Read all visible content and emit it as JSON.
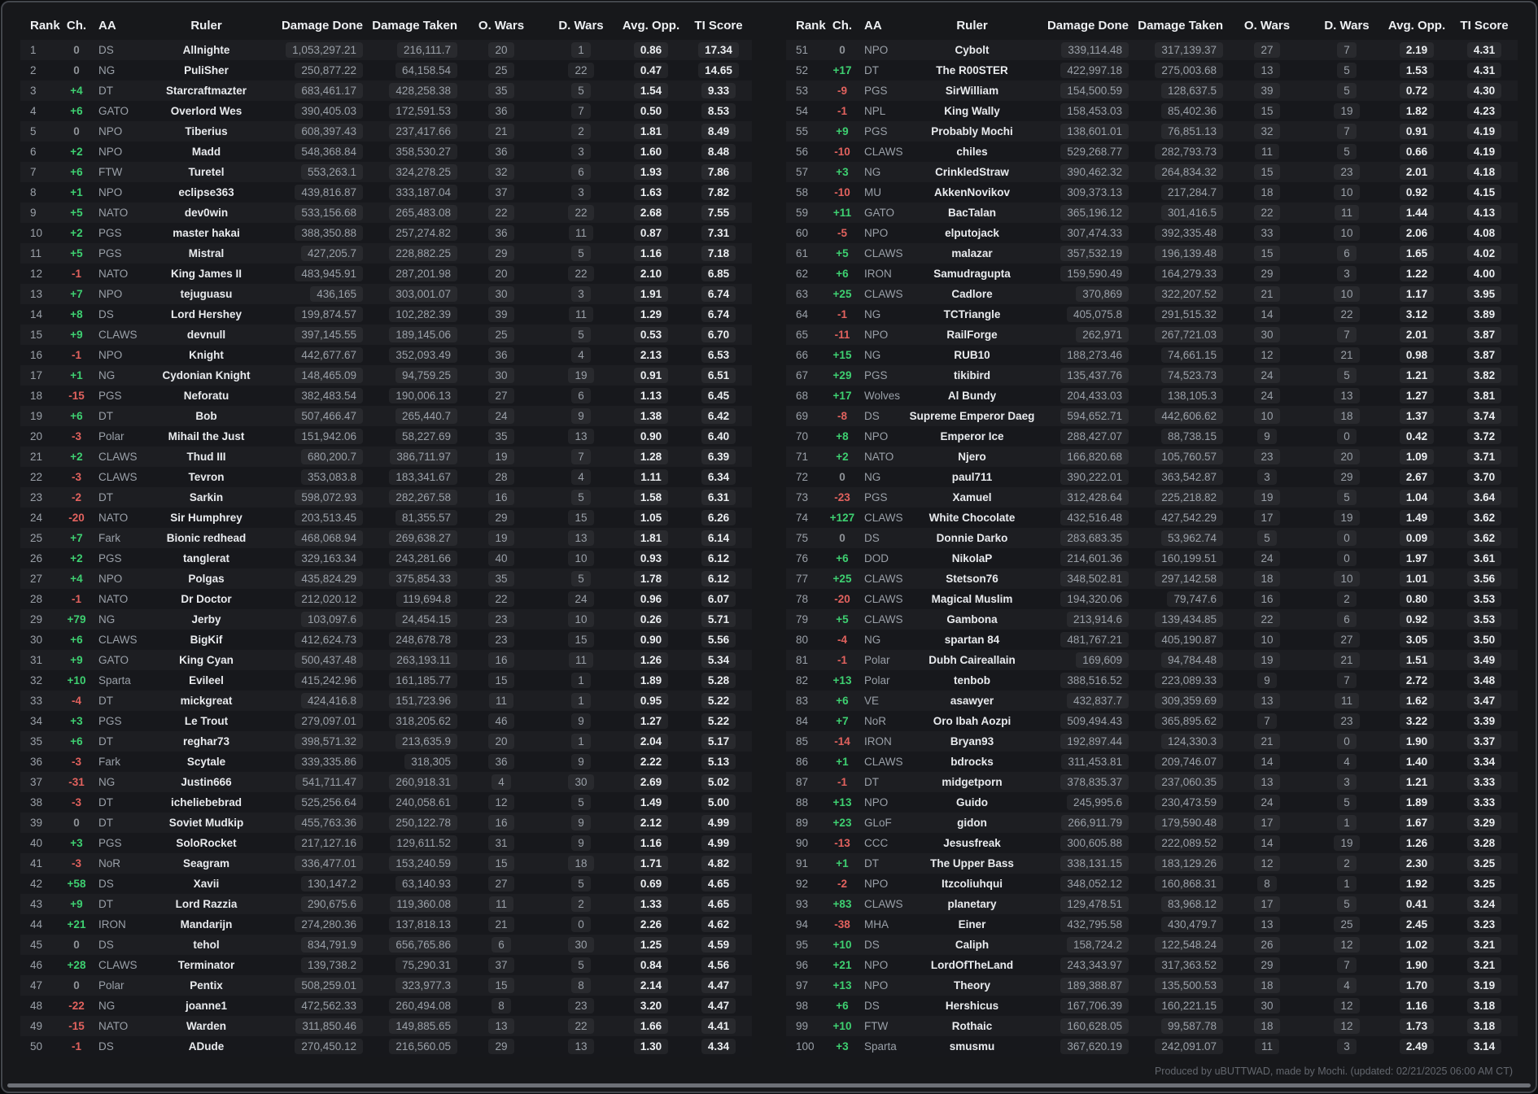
{
  "columns": [
    "Rank",
    "Ch.",
    "AA",
    "Ruler",
    "Damage Done",
    "Damage Taken",
    "O. Wars",
    "D. Wars",
    "Avg. Opp.",
    "TI Score"
  ],
  "colors": {
    "positive": "#3ed071",
    "negative": "#e2625e",
    "neutral": "#8f9398",
    "accent_bg": "#1d1e22"
  },
  "footer": {
    "text": "Produced by uBUTTWAD, made by Mochi. (updated: 02/21/2025 06:00 AM CT)"
  },
  "left_table": {
    "rows": [
      [
        "1",
        "0",
        "DS",
        "Allnighte",
        "1,053,297.21",
        "216,111.7",
        "20",
        "1",
        "0.86",
        "17.34"
      ],
      [
        "2",
        "0",
        "NG",
        "PuliSher",
        "250,877.22",
        "64,158.54",
        "25",
        "22",
        "0.47",
        "14.65"
      ],
      [
        "3",
        "+4",
        "DT",
        "Starcraftmazter",
        "683,461.17",
        "428,258.38",
        "35",
        "5",
        "1.54",
        "9.33"
      ],
      [
        "4",
        "+6",
        "GATO",
        "Overlord Wes",
        "390,405.03",
        "172,591.53",
        "36",
        "7",
        "0.50",
        "8.53"
      ],
      [
        "5",
        "0",
        "NPO",
        "Tiberius",
        "608,397.43",
        "237,417.66",
        "21",
        "2",
        "1.81",
        "8.49"
      ],
      [
        "6",
        "+2",
        "NPO",
        "Madd",
        "548,368.84",
        "358,530.27",
        "36",
        "3",
        "1.60",
        "8.48"
      ],
      [
        "7",
        "+6",
        "FTW",
        "Turetel",
        "553,263.1",
        "324,278.25",
        "32",
        "6",
        "1.93",
        "7.86"
      ],
      [
        "8",
        "+1",
        "NPO",
        "eclipse363",
        "439,816.87",
        "333,187.04",
        "37",
        "3",
        "1.63",
        "7.82"
      ],
      [
        "9",
        "+5",
        "NATO",
        "dev0win",
        "533,156.68",
        "265,483.08",
        "22",
        "22",
        "2.68",
        "7.55"
      ],
      [
        "10",
        "+2",
        "PGS",
        "master hakai",
        "388,350.88",
        "257,274.82",
        "36",
        "11",
        "0.87",
        "7.31"
      ],
      [
        "11",
        "+5",
        "PGS",
        "Mistral",
        "427,205.7",
        "228,882.25",
        "29",
        "5",
        "1.16",
        "7.18"
      ],
      [
        "12",
        "-1",
        "NATO",
        "King James II",
        "483,945.91",
        "287,201.98",
        "20",
        "22",
        "2.10",
        "6.85"
      ],
      [
        "13",
        "+7",
        "NPO",
        "tejuguasu",
        "436,165",
        "303,001.07",
        "30",
        "3",
        "1.91",
        "6.74"
      ],
      [
        "14",
        "+8",
        "DS",
        "Lord Hershey",
        "199,874.57",
        "102,282.39",
        "39",
        "11",
        "1.29",
        "6.74"
      ],
      [
        "15",
        "+9",
        "CLAWS",
        "devnull",
        "397,145.55",
        "189,145.06",
        "25",
        "5",
        "0.53",
        "6.70"
      ],
      [
        "16",
        "-1",
        "NPO",
        "Knight",
        "442,677.67",
        "352,093.49",
        "36",
        "4",
        "2.13",
        "6.53"
      ],
      [
        "17",
        "+1",
        "NG",
        "Cydonian Knight",
        "148,465.09",
        "94,759.25",
        "30",
        "19",
        "0.91",
        "6.51"
      ],
      [
        "18",
        "-15",
        "PGS",
        "Neforatu",
        "382,483.54",
        "190,006.13",
        "27",
        "6",
        "1.13",
        "6.45"
      ],
      [
        "19",
        "+6",
        "DT",
        "Bob",
        "507,466.47",
        "265,440.7",
        "24",
        "9",
        "1.38",
        "6.42"
      ],
      [
        "20",
        "-3",
        "Polar",
        "Mihail the Just",
        "151,942.06",
        "58,227.69",
        "35",
        "13",
        "0.90",
        "6.40"
      ],
      [
        "21",
        "+2",
        "CLAWS",
        "Thud III",
        "680,200.7",
        "386,711.97",
        "19",
        "7",
        "1.28",
        "6.39"
      ],
      [
        "22",
        "-3",
        "CLAWS",
        "Tevron",
        "353,083.8",
        "183,341.67",
        "28",
        "4",
        "1.11",
        "6.34"
      ],
      [
        "23",
        "-2",
        "DT",
        "Sarkin",
        "598,072.93",
        "282,267.58",
        "16",
        "5",
        "1.58",
        "6.31"
      ],
      [
        "24",
        "-20",
        "NATO",
        "Sir Humphrey",
        "203,513.45",
        "81,355.57",
        "29",
        "15",
        "1.05",
        "6.26"
      ],
      [
        "25",
        "+7",
        "Fark",
        "Bionic redhead",
        "468,068.94",
        "269,638.27",
        "19",
        "13",
        "1.81",
        "6.14"
      ],
      [
        "26",
        "+2",
        "PGS",
        "tanglerat",
        "329,163.34",
        "243,281.66",
        "40",
        "10",
        "0.93",
        "6.12"
      ],
      [
        "27",
        "+4",
        "NPO",
        "Polgas",
        "435,824.29",
        "375,854.33",
        "35",
        "5",
        "1.78",
        "6.12"
      ],
      [
        "28",
        "-1",
        "NATO",
        "Dr Doctor",
        "212,020.12",
        "119,694.8",
        "22",
        "24",
        "0.96",
        "6.07"
      ],
      [
        "29",
        "+79",
        "NG",
        "Jerby",
        "103,097.6",
        "24,454.15",
        "23",
        "10",
        "0.26",
        "5.71"
      ],
      [
        "30",
        "+6",
        "CLAWS",
        "BigKif",
        "412,624.73",
        "248,678.78",
        "23",
        "15",
        "0.90",
        "5.56"
      ],
      [
        "31",
        "+9",
        "GATO",
        "King Cyan",
        "500,437.48",
        "263,193.11",
        "16",
        "11",
        "1.26",
        "5.34"
      ],
      [
        "32",
        "+10",
        "Sparta",
        "Evileel",
        "415,242.96",
        "161,185.77",
        "15",
        "1",
        "1.89",
        "5.28"
      ],
      [
        "33",
        "-4",
        "DT",
        "mickgreat",
        "424,416.8",
        "151,723.96",
        "11",
        "1",
        "0.95",
        "5.22"
      ],
      [
        "34",
        "+3",
        "PGS",
        "Le Trout",
        "279,097.01",
        "318,205.62",
        "46",
        "9",
        "1.27",
        "5.22"
      ],
      [
        "35",
        "+6",
        "DT",
        "reghar73",
        "398,571.32",
        "213,635.9",
        "20",
        "1",
        "2.04",
        "5.17"
      ],
      [
        "36",
        "-3",
        "Fark",
        "Scytale",
        "339,335.86",
        "318,305",
        "36",
        "9",
        "2.22",
        "5.13"
      ],
      [
        "37",
        "-31",
        "NG",
        "Justin666",
        "541,711.47",
        "260,918.31",
        "4",
        "30",
        "2.69",
        "5.02"
      ],
      [
        "38",
        "-3",
        "DT",
        "icheliebebrad",
        "525,256.64",
        "240,058.61",
        "12",
        "5",
        "1.49",
        "5.00"
      ],
      [
        "39",
        "0",
        "DT",
        "Soviet Mudkip",
        "455,763.36",
        "250,122.78",
        "16",
        "9",
        "2.12",
        "4.99"
      ],
      [
        "40",
        "+3",
        "PGS",
        "SoloRocket",
        "217,127.16",
        "129,611.52",
        "31",
        "9",
        "1.16",
        "4.99"
      ],
      [
        "41",
        "-3",
        "NoR",
        "Seagram",
        "336,477.01",
        "153,240.59",
        "15",
        "18",
        "1.71",
        "4.82"
      ],
      [
        "42",
        "+58",
        "DS",
        "Xavii",
        "130,147.2",
        "63,140.93",
        "27",
        "5",
        "0.69",
        "4.65"
      ],
      [
        "43",
        "+9",
        "DT",
        "Lord Razzia",
        "290,675.6",
        "119,360.08",
        "11",
        "2",
        "1.33",
        "4.65"
      ],
      [
        "44",
        "+21",
        "IRON",
        "Mandarijn",
        "274,280.36",
        "137,818.13",
        "21",
        "0",
        "2.26",
        "4.62"
      ],
      [
        "45",
        "0",
        "DS",
        "tehol",
        "834,791.9",
        "656,765.86",
        "6",
        "30",
        "1.25",
        "4.59"
      ],
      [
        "46",
        "+28",
        "CLAWS",
        "Terminator",
        "139,738.2",
        "75,290.31",
        "37",
        "5",
        "0.84",
        "4.56"
      ],
      [
        "47",
        "0",
        "Polar",
        "Pentix",
        "508,259.01",
        "323,977.3",
        "15",
        "8",
        "2.14",
        "4.47"
      ],
      [
        "48",
        "-22",
        "NG",
        "joanne1",
        "472,562.33",
        "260,494.08",
        "8",
        "23",
        "3.20",
        "4.47"
      ],
      [
        "49",
        "-15",
        "NATO",
        "Warden",
        "311,850.46",
        "149,885.65",
        "13",
        "22",
        "1.66",
        "4.41"
      ],
      [
        "50",
        "-1",
        "DS",
        "ADude",
        "270,450.12",
        "216,560.05",
        "29",
        "13",
        "1.30",
        "4.34"
      ]
    ]
  },
  "right_table": {
    "rows": [
      [
        "51",
        "0",
        "NPO",
        "Cybolt",
        "339,114.48",
        "317,139.37",
        "27",
        "7",
        "2.19",
        "4.31"
      ],
      [
        "52",
        "+17",
        "DT",
        "The R00STER",
        "422,997.18",
        "275,003.68",
        "13",
        "5",
        "1.53",
        "4.31"
      ],
      [
        "53",
        "-9",
        "PGS",
        "SirWilliam",
        "154,500.59",
        "128,637.5",
        "39",
        "5",
        "0.72",
        "4.30"
      ],
      [
        "54",
        "-1",
        "NPL",
        "King Wally",
        "158,453.03",
        "85,402.36",
        "15",
        "19",
        "1.82",
        "4.23"
      ],
      [
        "55",
        "+9",
        "PGS",
        "Probably Mochi",
        "138,601.01",
        "76,851.13",
        "32",
        "7",
        "0.91",
        "4.19"
      ],
      [
        "56",
        "-10",
        "CLAWS",
        "chiles",
        "529,268.77",
        "282,793.73",
        "11",
        "5",
        "0.66",
        "4.19"
      ],
      [
        "57",
        "+3",
        "NG",
        "CrinkledStraw",
        "390,462.32",
        "264,834.32",
        "15",
        "23",
        "2.01",
        "4.18"
      ],
      [
        "58",
        "-10",
        "MU",
        "AkkenNovikov",
        "309,373.13",
        "217,284.7",
        "18",
        "10",
        "0.92",
        "4.15"
      ],
      [
        "59",
        "+11",
        "GATO",
        "BacTalan",
        "365,196.12",
        "301,416.5",
        "22",
        "11",
        "1.44",
        "4.13"
      ],
      [
        "60",
        "-5",
        "NPO",
        "elputojack",
        "307,474.33",
        "392,335.48",
        "33",
        "10",
        "2.06",
        "4.08"
      ],
      [
        "61",
        "+5",
        "CLAWS",
        "malazar",
        "357,532.19",
        "196,139.48",
        "15",
        "6",
        "1.65",
        "4.02"
      ],
      [
        "62",
        "+6",
        "IRON",
        "Samudragupta",
        "159,590.49",
        "164,279.33",
        "29",
        "3",
        "1.22",
        "4.00"
      ],
      [
        "63",
        "+25",
        "CLAWS",
        "Cadlore",
        "370,869",
        "322,207.52",
        "21",
        "10",
        "1.17",
        "3.95"
      ],
      [
        "64",
        "-1",
        "NG",
        "TCTriangle",
        "405,075.8",
        "291,515.32",
        "14",
        "22",
        "3.12",
        "3.89"
      ],
      [
        "65",
        "-11",
        "NPO",
        "RailForge",
        "262,971",
        "267,721.03",
        "30",
        "7",
        "2.01",
        "3.87"
      ],
      [
        "66",
        "+15",
        "NG",
        "RUB10",
        "188,273.46",
        "74,661.15",
        "12",
        "21",
        "0.98",
        "3.87"
      ],
      [
        "67",
        "+29",
        "PGS",
        "tikibird",
        "135,437.76",
        "74,523.73",
        "24",
        "5",
        "1.21",
        "3.82"
      ],
      [
        "68",
        "+17",
        "Wolves",
        "Al Bundy",
        "204,433.03",
        "138,105.3",
        "24",
        "13",
        "1.27",
        "3.81"
      ],
      [
        "69",
        "-8",
        "DS",
        "Supreme Emperor Daeg",
        "594,652.71",
        "442,606.62",
        "10",
        "18",
        "1.37",
        "3.74"
      ],
      [
        "70",
        "+8",
        "NPO",
        "Emperor Ice",
        "288,427.07",
        "88,738.15",
        "9",
        "0",
        "0.42",
        "3.72"
      ],
      [
        "71",
        "+2",
        "NATO",
        "Njero",
        "166,820.68",
        "105,760.57",
        "23",
        "20",
        "1.09",
        "3.71"
      ],
      [
        "72",
        "0",
        "NG",
        "paul711",
        "390,222.01",
        "363,542.87",
        "3",
        "29",
        "2.67",
        "3.70"
      ],
      [
        "73",
        "-23",
        "PGS",
        "Xamuel",
        "312,428.64",
        "225,218.82",
        "19",
        "5",
        "1.04",
        "3.64"
      ],
      [
        "74",
        "+127",
        "CLAWS",
        "White Chocolate",
        "432,516.48",
        "427,542.29",
        "17",
        "19",
        "1.49",
        "3.62"
      ],
      [
        "75",
        "0",
        "DS",
        "Donnie Darko",
        "283,683.35",
        "53,962.74",
        "5",
        "0",
        "0.09",
        "3.62"
      ],
      [
        "76",
        "+6",
        "DOD",
        "NikolaP",
        "214,601.36",
        "160,199.51",
        "24",
        "0",
        "1.97",
        "3.61"
      ],
      [
        "77",
        "+25",
        "CLAWS",
        "Stetson76",
        "348,502.81",
        "297,142.58",
        "18",
        "10",
        "1.01",
        "3.56"
      ],
      [
        "78",
        "-20",
        "CLAWS",
        "Magical Muslim",
        "194,320.06",
        "79,747.6",
        "16",
        "2",
        "0.80",
        "3.53"
      ],
      [
        "79",
        "+5",
        "CLAWS",
        "Gambona",
        "213,914.6",
        "139,434.85",
        "22",
        "6",
        "0.92",
        "3.53"
      ],
      [
        "80",
        "-4",
        "NG",
        "spartan 84",
        "481,767.21",
        "405,190.87",
        "10",
        "27",
        "3.05",
        "3.50"
      ],
      [
        "81",
        "-1",
        "Polar",
        "Dubh Caireallain",
        "169,609",
        "94,784.48",
        "19",
        "21",
        "1.51",
        "3.49"
      ],
      [
        "82",
        "+13",
        "Polar",
        "tenbob",
        "388,516.52",
        "223,089.33",
        "9",
        "7",
        "2.72",
        "3.48"
      ],
      [
        "83",
        "+6",
        "VE",
        "asawyer",
        "432,837.7",
        "309,359.69",
        "13",
        "11",
        "1.62",
        "3.47"
      ],
      [
        "84",
        "+7",
        "NoR",
        "Oro Ibah Aozpi",
        "509,494.43",
        "365,895.62",
        "7",
        "23",
        "3.22",
        "3.39"
      ],
      [
        "85",
        "-14",
        "IRON",
        "Bryan93",
        "192,897.44",
        "124,330.3",
        "21",
        "0",
        "1.90",
        "3.37"
      ],
      [
        "86",
        "+1",
        "CLAWS",
        "bdrocks",
        "311,453.81",
        "209,746.07",
        "14",
        "4",
        "1.40",
        "3.34"
      ],
      [
        "87",
        "-1",
        "DT",
        "midgetporn",
        "378,835.37",
        "237,060.35",
        "13",
        "3",
        "1.21",
        "3.33"
      ],
      [
        "88",
        "+13",
        "NPO",
        "Guido",
        "245,995.6",
        "230,473.59",
        "24",
        "5",
        "1.89",
        "3.33"
      ],
      [
        "89",
        "+23",
        "GLoF",
        "gidon",
        "266,911.79",
        "179,590.48",
        "17",
        "1",
        "1.67",
        "3.29"
      ],
      [
        "90",
        "-13",
        "CCC",
        "Jesusfreak",
        "300,605.88",
        "222,089.52",
        "14",
        "19",
        "1.26",
        "3.28"
      ],
      [
        "91",
        "+1",
        "DT",
        "The Upper Bass",
        "338,131.15",
        "183,129.26",
        "12",
        "2",
        "2.30",
        "3.25"
      ],
      [
        "92",
        "-2",
        "NPO",
        "Itzcoliuhqui",
        "348,052.12",
        "160,868.31",
        "8",
        "1",
        "1.92",
        "3.25"
      ],
      [
        "93",
        "+83",
        "CLAWS",
        "planetary",
        "129,478.51",
        "83,968.12",
        "17",
        "5",
        "0.41",
        "3.24"
      ],
      [
        "94",
        "-38",
        "MHA",
        "Einer",
        "432,795.58",
        "430,479.7",
        "13",
        "25",
        "2.45",
        "3.23"
      ],
      [
        "95",
        "+10",
        "DS",
        "Caliph",
        "158,724.2",
        "122,548.24",
        "26",
        "12",
        "1.02",
        "3.21"
      ],
      [
        "96",
        "+21",
        "NPO",
        "LordOfTheLand",
        "243,343.97",
        "317,363.52",
        "29",
        "7",
        "1.90",
        "3.21"
      ],
      [
        "97",
        "+13",
        "NPO",
        "Theory",
        "189,388.87",
        "135,500.53",
        "18",
        "4",
        "1.70",
        "3.19"
      ],
      [
        "98",
        "+6",
        "DS",
        "Hershicus",
        "167,706.39",
        "160,221.15",
        "30",
        "12",
        "1.16",
        "3.18"
      ],
      [
        "99",
        "+10",
        "FTW",
        "Rothaic",
        "160,628.05",
        "99,587.78",
        "18",
        "12",
        "1.73",
        "3.18"
      ],
      [
        "100",
        "+3",
        "Sparta",
        "smusmu",
        "367,620.19",
        "242,091.07",
        "11",
        "3",
        "2.49",
        "3.14"
      ]
    ]
  }
}
